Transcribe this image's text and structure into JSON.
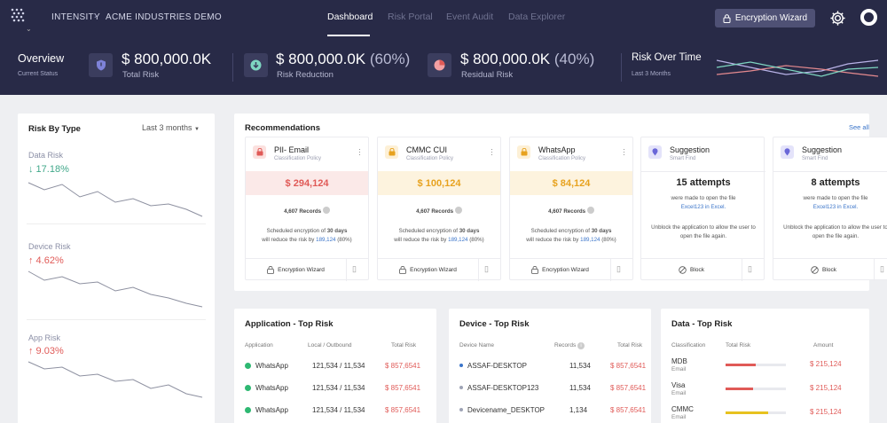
{
  "nav": {
    "brand": "INTENSITY",
    "org": "ACME INDUSTRIES DEMO",
    "tabs": [
      "Dashboard",
      "Risk Portal",
      "Event Audit",
      "Data Explorer"
    ],
    "active_tab": "Dashboard",
    "encrypt_button": "Encryption Wizard",
    "accent": "#282a47"
  },
  "overview": {
    "title": "Overview",
    "subtitle": "Current Status",
    "total": {
      "value": "$ 800,000.0K",
      "label": "Total Risk"
    },
    "reduction": {
      "value": "$ 800,000.0K",
      "pct": "(60%)",
      "label": "Risk Reduction"
    },
    "residual": {
      "value": "$ 800,000.0K",
      "pct": "(40%)",
      "label": "Residual Risk"
    },
    "rot": {
      "title": "Risk Over Time",
      "subtitle": "Last 3 Months"
    }
  },
  "risk_by_type": {
    "title": "Risk By Type",
    "period": "Last 3 months",
    "items": [
      {
        "label": "Data Risk",
        "value": "↓ 17.18%",
        "trend": "down"
      },
      {
        "label": "Device Risk",
        "value": "↑ 4.62%",
        "trend": "up"
      },
      {
        "label": "App Risk",
        "value": "↑ 9.03%",
        "trend": "up"
      }
    ]
  },
  "recommendations": {
    "title": "Recommendations",
    "see_all": "See all",
    "policy_cards": [
      {
        "title": "PII- Email",
        "subtitle": "Classification Policy",
        "amount": "$ 294,124",
        "records": "4,607 Records",
        "sched1": "Scheduled encryption of ",
        "days": "30 days",
        "sched2": "will reduce the risk by ",
        "by": "189,124",
        "pct": " (80%)",
        "button": "Encryption Wizard",
        "color": "#e05a57",
        "band": "#fbe9e8",
        "icon_bg": "#fbe1df"
      },
      {
        "title": "CMMC CUI",
        "subtitle": "Classification Policy",
        "amount": "$ 100,124",
        "records": "4,607 Records",
        "sched1": "Scheduled encryption of ",
        "days": "30 days",
        "sched2": "will reduce the risk by ",
        "by": "189,124",
        "pct": " (80%)",
        "button": "Encryption Wizard",
        "color": "#e7a21f",
        "band": "#fdf3de",
        "icon_bg": "#fdf0d6"
      },
      {
        "title": "WhatsApp",
        "subtitle": "Classification Policy",
        "amount": "$ 84,124",
        "records": "4,607 Records",
        "sched1": "Scheduled encryption of ",
        "days": "30 days",
        "sched2": "will reduce the risk by ",
        "by": "189,124",
        "pct": " (80%)",
        "button": "Encryption Wizard",
        "color": "#e7a21f",
        "band": "#fdf3de",
        "icon_bg": "#fdf0d6"
      }
    ],
    "suggestion_cards": [
      {
        "title": "Suggestion",
        "subtitle": "Smart Find",
        "attempts": "15 attempts",
        "line1": "were made to open the file",
        "file": "Excel123 in Excel.",
        "line2": "Unblock the application to allow the user to open the file again.",
        "button": "Block"
      },
      {
        "title": "Suggestion",
        "subtitle": "Smart Find",
        "attempts": "8 attempts",
        "line1": "were made to open the file",
        "file": "Excel123 in Excel.",
        "line2": "Unblock the application to allow the user to open the file again.",
        "button": "Block"
      }
    ]
  },
  "app_table": {
    "title": "Application - Top Risk",
    "headers": [
      "Application",
      "Local / Outbound",
      "Total Risk"
    ],
    "rows": [
      {
        "app": "WhatsApp",
        "io": "121,534 / 11,534",
        "risk": "$ 857,6541"
      },
      {
        "app": "WhatsApp",
        "io": "121,534 / 11,534",
        "risk": "$ 857,6541"
      },
      {
        "app": "WhatsApp",
        "io": "121,534 / 11,534",
        "risk": "$ 857,6541"
      }
    ]
  },
  "device_table": {
    "title": "Device - Top Risk",
    "headers": [
      "Device Name",
      "Records",
      "Total Risk"
    ],
    "rows": [
      {
        "name": "ASSAF-DESKTOP",
        "records": "11,534",
        "risk": "$ 857,6541",
        "dot": "#3a74c9"
      },
      {
        "name": "ASSAF-DESKTOP123",
        "records": "11,534",
        "risk": "$ 857,6541",
        "dot": "#9ea3b5"
      },
      {
        "name": "Devicename_DESKTOP",
        "records": "1,134",
        "risk": "$ 857,6541",
        "dot": "#9ea3b5"
      }
    ]
  },
  "data_table": {
    "title": "Data - Top Risk",
    "headers": [
      "Classification",
      "Total Risk",
      "Amount"
    ],
    "rows": [
      {
        "name": "MDB",
        "sub": "Email",
        "amount": "$ 215,124",
        "fill": 0.5,
        "color": "#e05a57"
      },
      {
        "name": "Visa",
        "sub": "Email",
        "amount": "$ 215,124",
        "fill": 0.45,
        "color": "#e05a57"
      },
      {
        "name": "CMMC",
        "sub": "Email",
        "amount": "$ 215,124",
        "fill": 0.7,
        "color": "#e7c21f"
      }
    ]
  }
}
